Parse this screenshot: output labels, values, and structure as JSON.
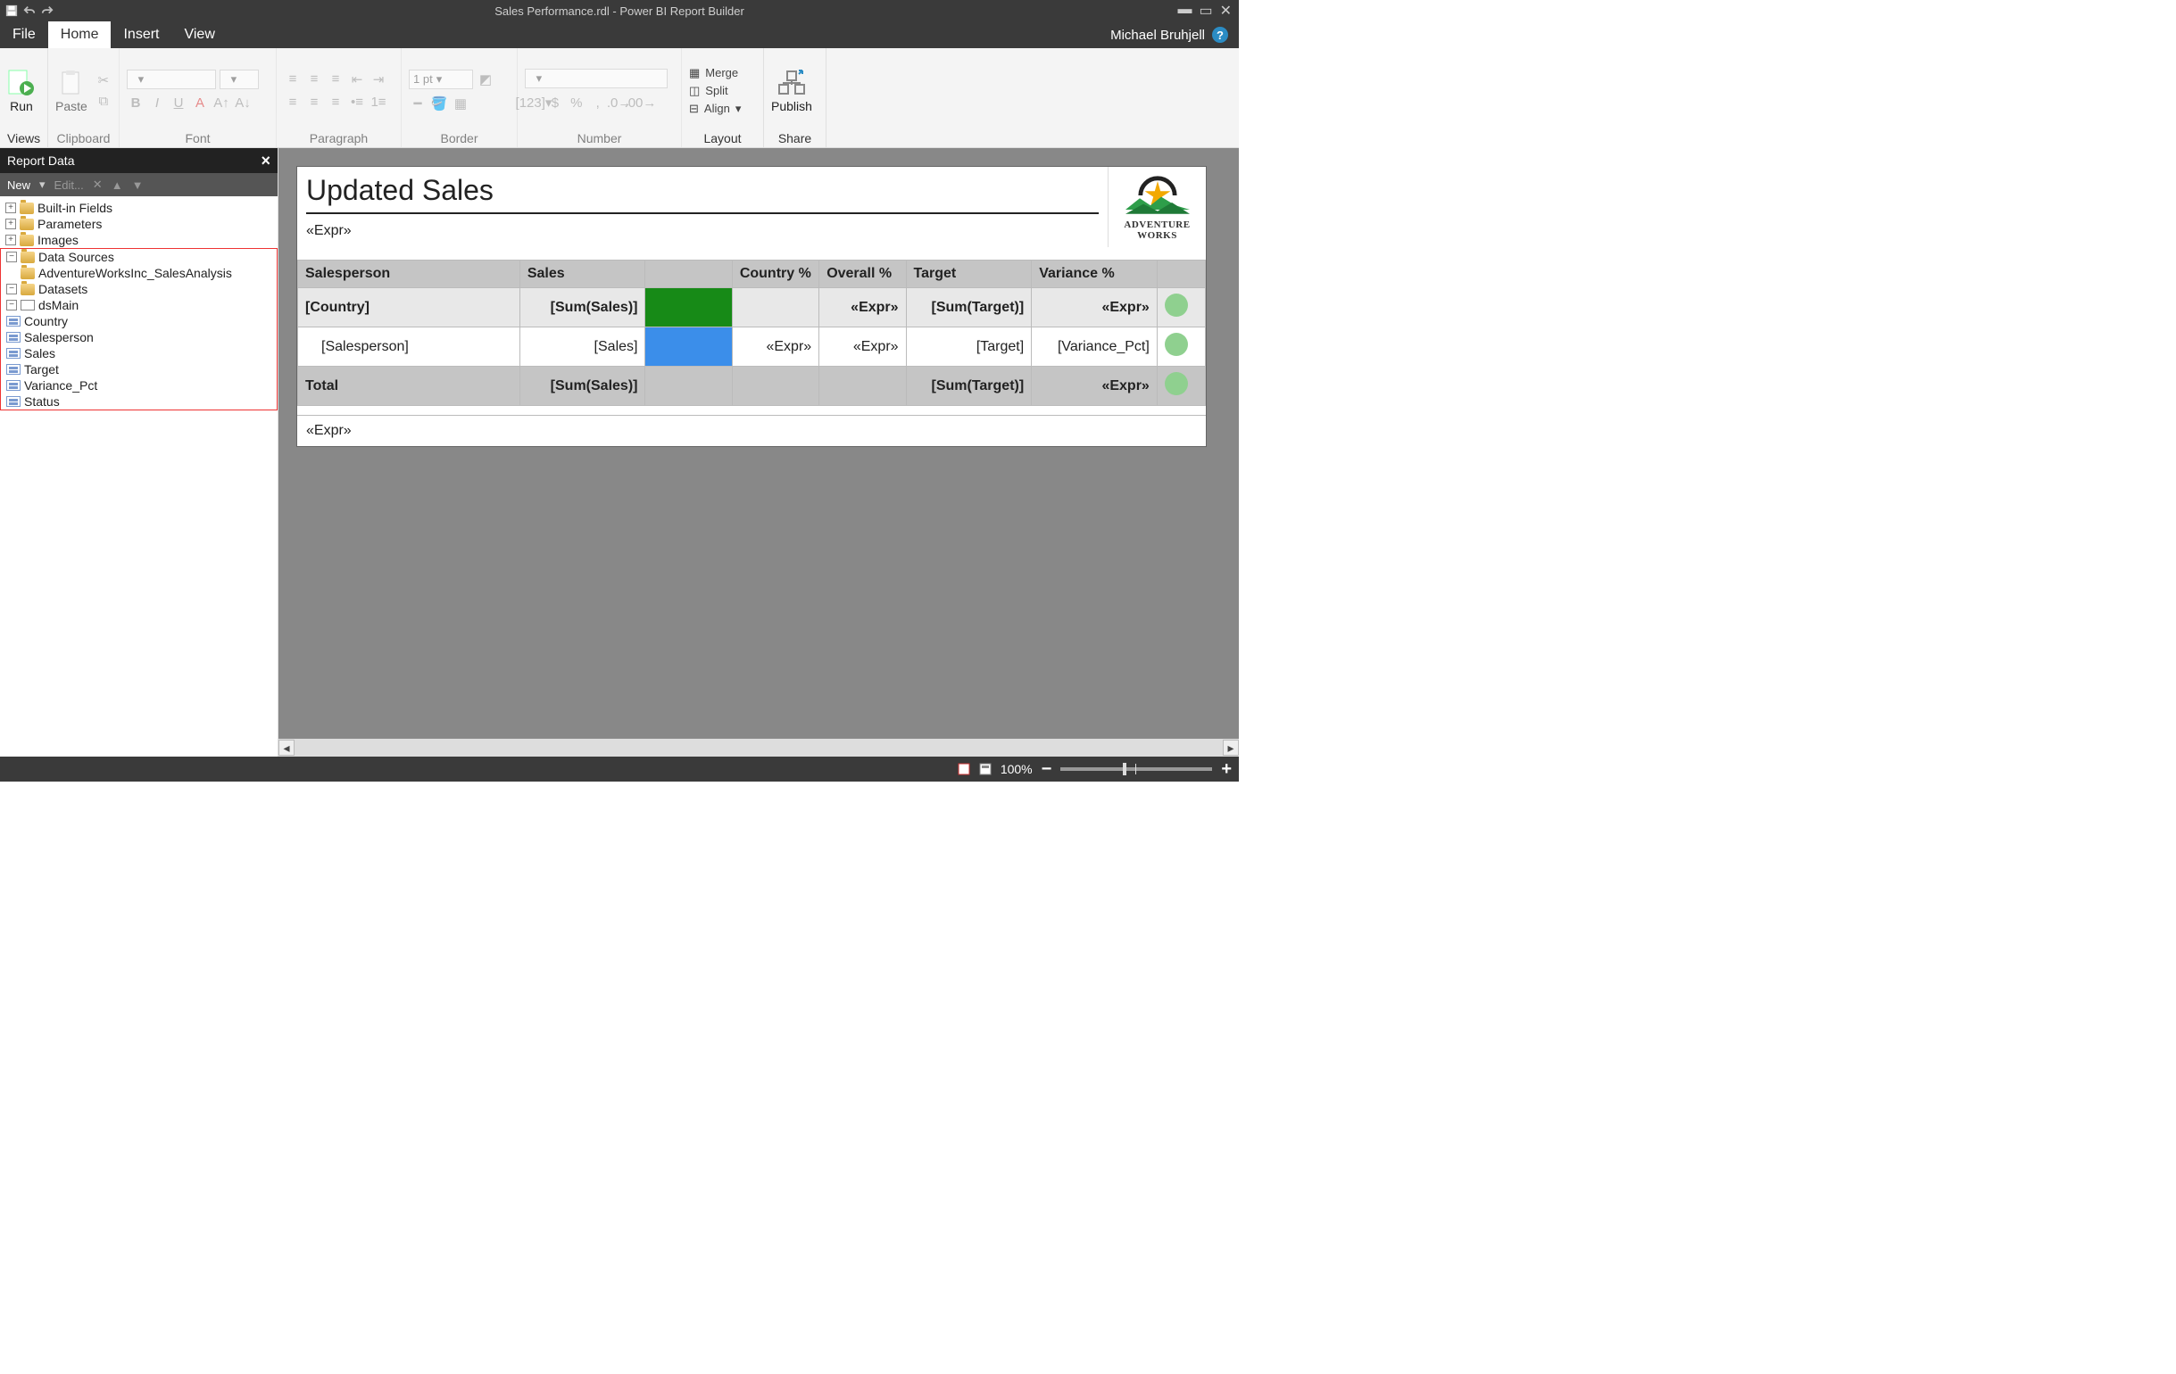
{
  "title": "Sales Performance.rdl - Power BI Report Builder",
  "user": "Michael Bruhjell",
  "tabs": [
    "File",
    "Home",
    "Insert",
    "View"
  ],
  "active_tab": "Home",
  "ribbon": {
    "groups": {
      "views": {
        "label": "Views",
        "run": "Run"
      },
      "clipboard": {
        "label": "Clipboard",
        "paste": "Paste"
      },
      "font": {
        "label": "Font"
      },
      "paragraph": {
        "label": "Paragraph"
      },
      "border": {
        "label": "Border",
        "line_width": "1 pt"
      },
      "number": {
        "label": "Number"
      },
      "layout": {
        "label": "Layout",
        "merge": "Merge",
        "split": "Split",
        "align": "Align"
      },
      "share": {
        "label": "Share",
        "publish": "Publish"
      }
    }
  },
  "panel": {
    "title": "Report Data",
    "toolbar": {
      "new": "New",
      "edit": "Edit..."
    },
    "nodes": {
      "builtin": "Built-in Fields",
      "parameters": "Parameters",
      "images": "Images",
      "datasources": "Data Sources",
      "ds_item": "AdventureWorksInc_SalesAnalysis",
      "datasets": "Datasets",
      "dsmain": "dsMain",
      "fields": [
        "Country",
        "Salesperson",
        "Sales",
        "Target",
        "Variance_Pct",
        "Status"
      ]
    }
  },
  "report": {
    "title": "Updated Sales",
    "expr_placeholder": "«Expr»",
    "logo_brand_1": "ADVENTURE",
    "logo_brand_2": "WORKS",
    "headers": [
      "Salesperson",
      "Sales",
      "",
      "Country %",
      "Overall %",
      "Target",
      "Variance %",
      ""
    ],
    "row_country": [
      "[Country]",
      "[Sum(Sales)]",
      "",
      "",
      "«Expr»",
      "[Sum(Target)]",
      "«Expr»",
      ""
    ],
    "row_detail": [
      "[Salesperson]",
      "[Sales]",
      "",
      "«Expr»",
      "«Expr»",
      "[Target]",
      "[Variance_Pct]",
      ""
    ],
    "row_total": [
      "Total",
      "[Sum(Sales)]",
      "",
      "",
      "",
      "[Sum(Target)]",
      "«Expr»",
      ""
    ]
  },
  "status": {
    "zoom": "100%"
  }
}
